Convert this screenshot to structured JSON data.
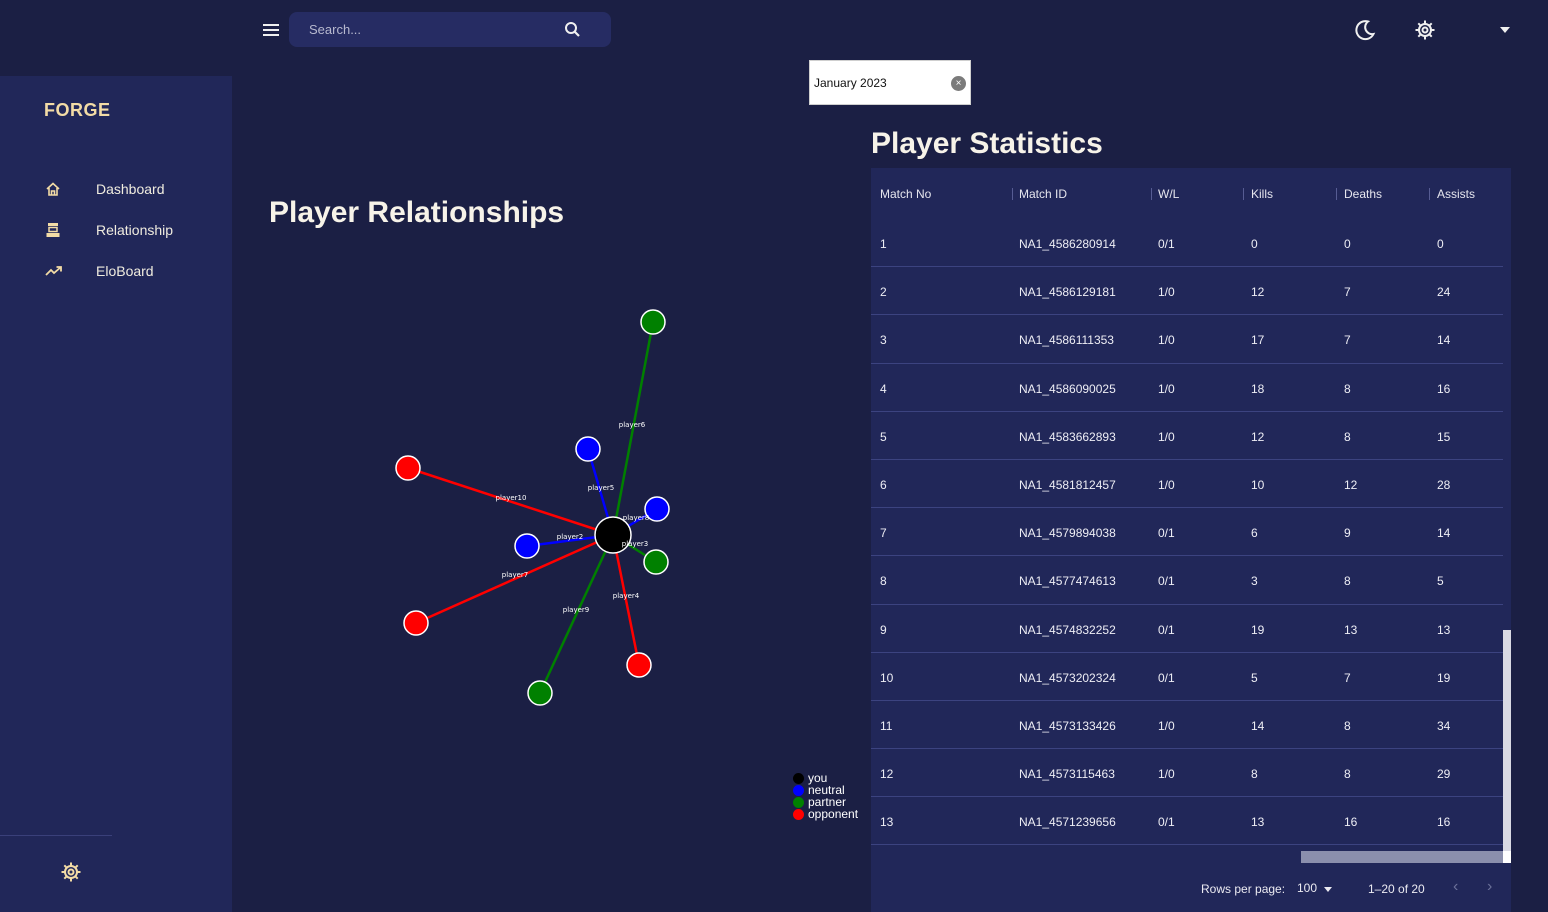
{
  "sidebar": {
    "brand": "FORGE",
    "items": [
      {
        "label": "Dashboard",
        "icon": "home-icon"
      },
      {
        "label": "Relationship",
        "icon": "rank-icon"
      },
      {
        "label": "EloBoard",
        "icon": "trending-up-icon"
      }
    ],
    "bottom_icon": "gear-icon"
  },
  "topbar": {
    "search_placeholder": "Search...",
    "icons": [
      "menu-icon",
      "search-icon",
      "moon-icon",
      "gear-icon",
      "chevron-down-icon"
    ]
  },
  "date_filter": {
    "value": "January 2023"
  },
  "relationships": {
    "title": "Player Relationships",
    "center": "you",
    "nodes": [
      {
        "label": "player6",
        "type": "partner"
      },
      {
        "label": "player5",
        "type": "neutral"
      },
      {
        "label": "player10",
        "type": "opponent"
      },
      {
        "label": "player8",
        "type": "neutral"
      },
      {
        "label": "player2",
        "type": "neutral"
      },
      {
        "label": "player3",
        "type": "partner"
      },
      {
        "label": "player7",
        "type": "opponent"
      },
      {
        "label": "player4",
        "type": "opponent"
      },
      {
        "label": "player9",
        "type": "partner"
      }
    ],
    "legend": [
      {
        "label": "you",
        "color": "#000000"
      },
      {
        "label": "neutral",
        "color": "#0000ff"
      },
      {
        "label": "partner",
        "color": "#008000"
      },
      {
        "label": "opponent",
        "color": "#ff0000"
      }
    ]
  },
  "stats": {
    "title": "Player Statistics",
    "columns": [
      "Match No",
      "Match ID",
      "W/L",
      "Kills",
      "Deaths",
      "Assists"
    ],
    "rows": [
      [
        "1",
        "NA1_4586280914",
        "0/1",
        "0",
        "0",
        "0"
      ],
      [
        "2",
        "NA1_4586129181",
        "1/0",
        "12",
        "7",
        "24"
      ],
      [
        "3",
        "NA1_4586111353",
        "1/0",
        "17",
        "7",
        "14"
      ],
      [
        "4",
        "NA1_4586090025",
        "1/0",
        "18",
        "8",
        "16"
      ],
      [
        "5",
        "NA1_4583662893",
        "1/0",
        "12",
        "8",
        "15"
      ],
      [
        "6",
        "NA1_4581812457",
        "1/0",
        "10",
        "12",
        "28"
      ],
      [
        "7",
        "NA1_4579894038",
        "0/1",
        "6",
        "9",
        "14"
      ],
      [
        "8",
        "NA1_4577474613",
        "0/1",
        "3",
        "8",
        "5"
      ],
      [
        "9",
        "NA1_4574832252",
        "0/1",
        "19",
        "13",
        "13"
      ],
      [
        "10",
        "NA1_4573202324",
        "0/1",
        "5",
        "7",
        "19"
      ],
      [
        "11",
        "NA1_4573133426",
        "1/0",
        "14",
        "8",
        "34"
      ],
      [
        "12",
        "NA1_4573115463",
        "1/0",
        "8",
        "8",
        "29"
      ],
      [
        "13",
        "NA1_4571239656",
        "0/1",
        "13",
        "16",
        "16"
      ]
    ],
    "footer": {
      "rows_per_page_label": "Rows per page:",
      "rows_per_page": "100",
      "range": "1–20 of 20"
    }
  }
}
